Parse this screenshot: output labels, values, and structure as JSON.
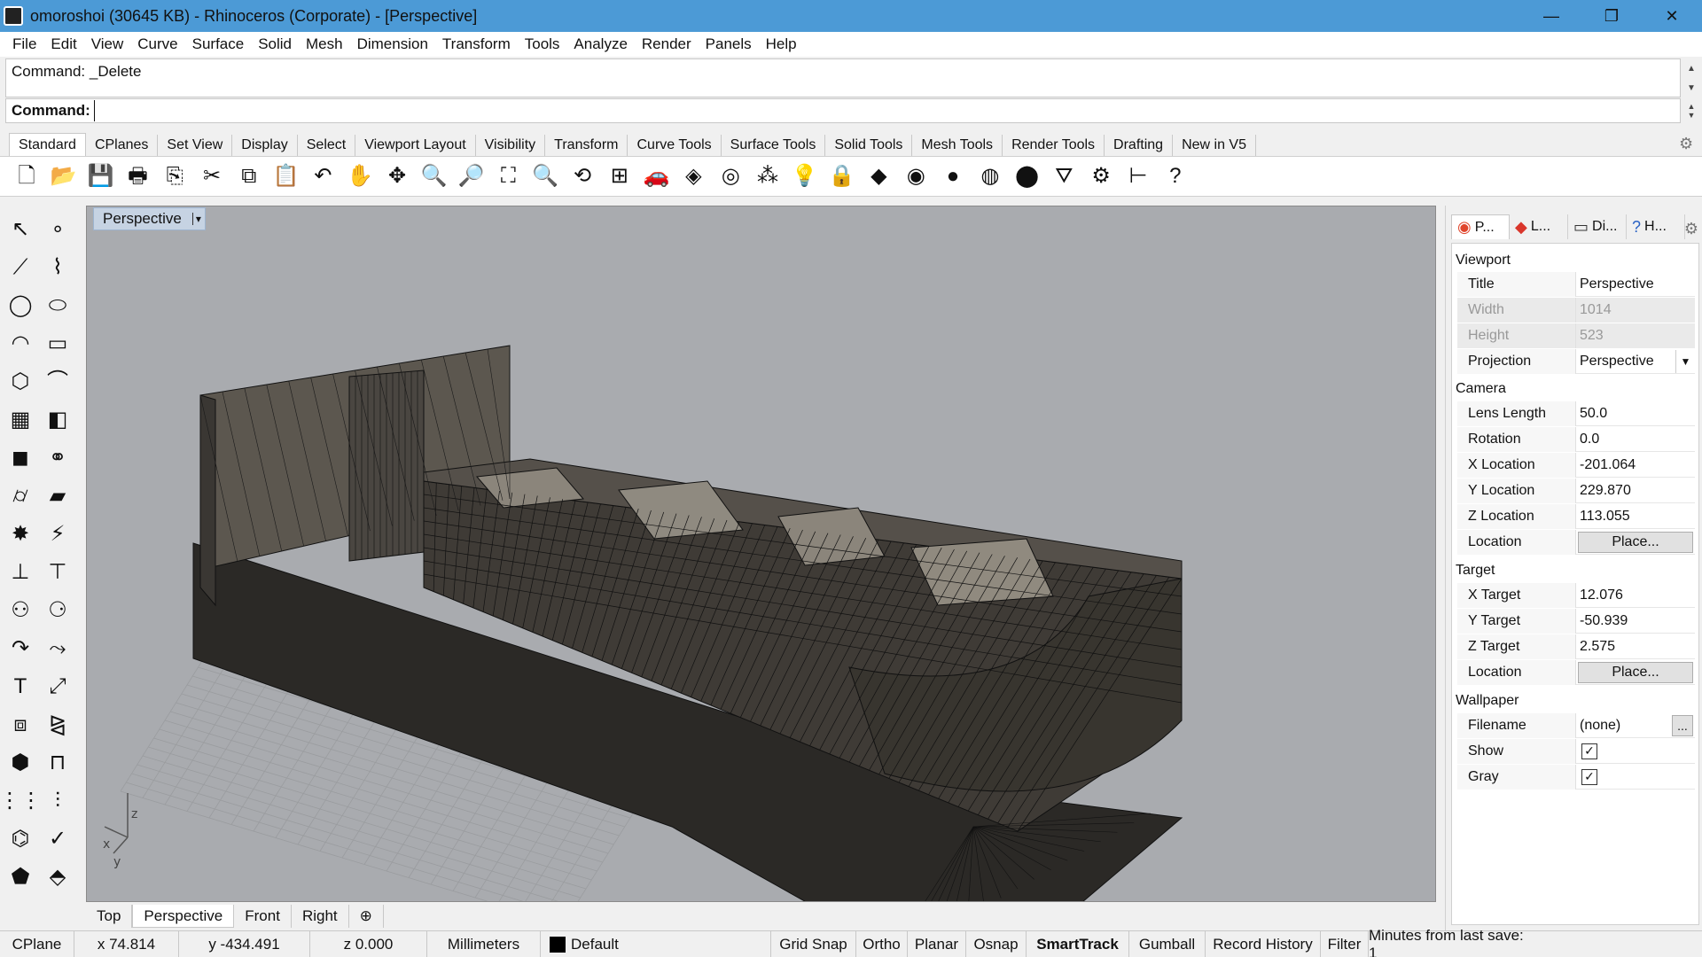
{
  "window": {
    "title": "omoroshoi (30645 KB) - Rhinoceros (Corporate) - [Perspective]",
    "controls": {
      "minimize": "—",
      "restore": "❐",
      "close": "✕"
    }
  },
  "menu": [
    "File",
    "Edit",
    "View",
    "Curve",
    "Surface",
    "Solid",
    "Mesh",
    "Dimension",
    "Transform",
    "Tools",
    "Analyze",
    "Render",
    "Panels",
    "Help"
  ],
  "command": {
    "history": "Command: _Delete",
    "prompt": "Command:",
    "value": ""
  },
  "toolbar_tabs": [
    "Standard",
    "CPlanes",
    "Set View",
    "Display",
    "Select",
    "Viewport Layout",
    "Visibility",
    "Transform",
    "Curve Tools",
    "Surface Tools",
    "Solid Tools",
    "Mesh Tools",
    "Render Tools",
    "Drafting",
    "New in V5"
  ],
  "toolbar_active_tab": "Standard",
  "toolbar_icons": [
    {
      "name": "new-file-icon",
      "glyph": "🗋"
    },
    {
      "name": "open-folder-icon",
      "glyph": "📂"
    },
    {
      "name": "save-icon",
      "glyph": "💾"
    },
    {
      "name": "print-icon",
      "glyph": "🖶"
    },
    {
      "name": "export-icon",
      "glyph": "⎘"
    },
    {
      "name": "cut-icon",
      "glyph": "✂"
    },
    {
      "name": "copy-icon",
      "glyph": "⧉"
    },
    {
      "name": "paste-icon",
      "glyph": "📋"
    },
    {
      "name": "undo-icon",
      "glyph": "↶"
    },
    {
      "name": "pan-hand-icon",
      "glyph": "✋"
    },
    {
      "name": "rotate-view-icon",
      "glyph": "✥"
    },
    {
      "name": "zoom-dynamic-icon",
      "glyph": "🔍"
    },
    {
      "name": "zoom-window-icon",
      "glyph": "🔎"
    },
    {
      "name": "zoom-extents-icon",
      "glyph": "⛶"
    },
    {
      "name": "zoom-selected-icon",
      "glyph": "🔍"
    },
    {
      "name": "undo-view-icon",
      "glyph": "⟲"
    },
    {
      "name": "four-viewports-icon",
      "glyph": "⊞"
    },
    {
      "name": "car-icon",
      "glyph": "🚗"
    },
    {
      "name": "shade-icon",
      "glyph": "◈"
    },
    {
      "name": "circle-select-icon",
      "glyph": "◎"
    },
    {
      "name": "points-icon",
      "glyph": "⁂"
    },
    {
      "name": "light-bulb-icon",
      "glyph": "💡"
    },
    {
      "name": "lock-icon",
      "glyph": "🔒"
    },
    {
      "name": "layer-icon",
      "glyph": "◆"
    },
    {
      "name": "color-wheel-icon",
      "glyph": "◉"
    },
    {
      "name": "material-sphere-icon",
      "glyph": "●"
    },
    {
      "name": "render-sphere-icon",
      "glyph": "◍"
    },
    {
      "name": "blue-sphere-icon",
      "glyph": "⬤"
    },
    {
      "name": "filter-icon",
      "glyph": "⛛"
    },
    {
      "name": "options-gear-icon",
      "glyph": "⚙"
    },
    {
      "name": "dimension-icon",
      "glyph": "⊢"
    },
    {
      "name": "help-icon",
      "glyph": "?"
    }
  ],
  "palette_icons": [
    {
      "name": "select-arrow-icon",
      "glyph": "↖"
    },
    {
      "name": "point-icon",
      "glyph": "∘"
    },
    {
      "name": "polyline-icon",
      "glyph": "⟋"
    },
    {
      "name": "curve-points-icon",
      "glyph": "⌇"
    },
    {
      "name": "circle-icon",
      "glyph": "◯"
    },
    {
      "name": "ellipse-icon",
      "glyph": "⬭"
    },
    {
      "name": "arc-icon",
      "glyph": "◠"
    },
    {
      "name": "rectangle-icon",
      "glyph": "▭"
    },
    {
      "name": "polygon-icon",
      "glyph": "⬡"
    },
    {
      "name": "fillet-icon",
      "glyph": "⌒"
    },
    {
      "name": "surface-grid-icon",
      "glyph": "▦"
    },
    {
      "name": "surface-edge-icon",
      "glyph": "◧"
    },
    {
      "name": "box-icon",
      "glyph": "◼"
    },
    {
      "name": "boolean-icon",
      "glyph": "⚭"
    },
    {
      "name": "cylinder-icon",
      "glyph": "⌭"
    },
    {
      "name": "mesh-plane-icon",
      "glyph": "▰"
    },
    {
      "name": "explode-icon",
      "glyph": "✸"
    },
    {
      "name": "split-icon",
      "glyph": "⚡"
    },
    {
      "name": "trim-icon",
      "glyph": "⊥"
    },
    {
      "name": "split-surface-icon",
      "glyph": "⊤"
    },
    {
      "name": "group-icon",
      "glyph": "⚇"
    },
    {
      "name": "ungroup-icon",
      "glyph": "⚆"
    },
    {
      "name": "curve-from-object-icon",
      "glyph": "↷"
    },
    {
      "name": "rebuild-curve-icon",
      "glyph": "⤳"
    },
    {
      "name": "text-icon",
      "glyph": "T"
    },
    {
      "name": "scale-icon",
      "glyph": "⤢"
    },
    {
      "name": "array-icon",
      "glyph": "⧈"
    },
    {
      "name": "mirror-icon",
      "glyph": "⧎"
    },
    {
      "name": "solid-edit-icon",
      "glyph": "⬢"
    },
    {
      "name": "dimension-ruler-icon",
      "glyph": "⊓"
    },
    {
      "name": "grid-array-icon",
      "glyph": "⋮⋮"
    },
    {
      "name": "vertical-align-icon",
      "glyph": "⫶"
    },
    {
      "name": "analyze-icon",
      "glyph": "⌬"
    },
    {
      "name": "checkmark-icon",
      "glyph": "✓"
    },
    {
      "name": "render-object-icon",
      "glyph": "⬟"
    },
    {
      "name": "light-render-icon",
      "glyph": "⬘"
    }
  ],
  "viewport": {
    "title": "Perspective",
    "dropdown": "▾",
    "axis_x": "x",
    "axis_y": "y",
    "axis_z": "z"
  },
  "viewport_tabs": [
    "Top",
    "Perspective",
    "Front",
    "Right"
  ],
  "viewport_active_tab": "Perspective",
  "viewport_add_tab": "⊕",
  "panel_tabs": [
    {
      "label": "P...",
      "icon": "color-wheel-icon",
      "glyph": "◉"
    },
    {
      "label": "L...",
      "icon": "layers-icon",
      "glyph": "◆"
    },
    {
      "label": "Di...",
      "icon": "monitor-icon",
      "glyph": "▭"
    },
    {
      "label": "H...",
      "icon": "help-icon",
      "glyph": "?"
    }
  ],
  "properties": {
    "viewport_section": "Viewport",
    "title_label": "Title",
    "title_value": "Perspective",
    "width_label": "Width",
    "width_value": "1014",
    "height_label": "Height",
    "height_value": "523",
    "projection_label": "Projection",
    "projection_value": "Perspective",
    "camera_section": "Camera",
    "lens_label": "Lens Length",
    "lens_value": "50.0",
    "rotation_label": "Rotation",
    "rotation_value": "0.0",
    "xloc_label": "X Location",
    "xloc_value": "-201.064",
    "yloc_label": "Y Location",
    "yloc_value": "229.870",
    "zloc_label": "Z Location",
    "zloc_value": "113.055",
    "cam_location_label": "Location",
    "cam_place_button": "Place...",
    "target_section": "Target",
    "xtarget_label": "X Target",
    "xtarget_value": "12.076",
    "ytarget_label": "Y Target",
    "ytarget_value": "-50.939",
    "ztarget_label": "Z Target",
    "ztarget_value": "2.575",
    "target_location_label": "Location",
    "target_place_button": "Place...",
    "wallpaper_section": "Wallpaper",
    "filename_label": "Filename",
    "filename_value": "(none)",
    "filename_button": "...",
    "show_label": "Show",
    "gray_label": "Gray",
    "checkmark": "✓"
  },
  "status": {
    "cplane": "CPlane",
    "x": "x 74.814",
    "y": "y -434.491",
    "z": "z 0.000",
    "units": "Millimeters",
    "layer": "Default",
    "grid_snap": "Grid Snap",
    "ortho": "Ortho",
    "planar": "Planar",
    "osnap": "Osnap",
    "smarttrack": "SmartTrack",
    "gumball": "Gumball",
    "record_history": "Record History",
    "filter": "Filter",
    "minutes": "Minutes from last save: 1"
  },
  "colors": {
    "titlebar": "#4c9ad6",
    "viewport_bg": "#a9abaf",
    "model_dark": "#2a2826",
    "model_wall": "#5c574f",
    "grid_line": "#9a9c9f",
    "x_axis": "#2ea44f"
  }
}
